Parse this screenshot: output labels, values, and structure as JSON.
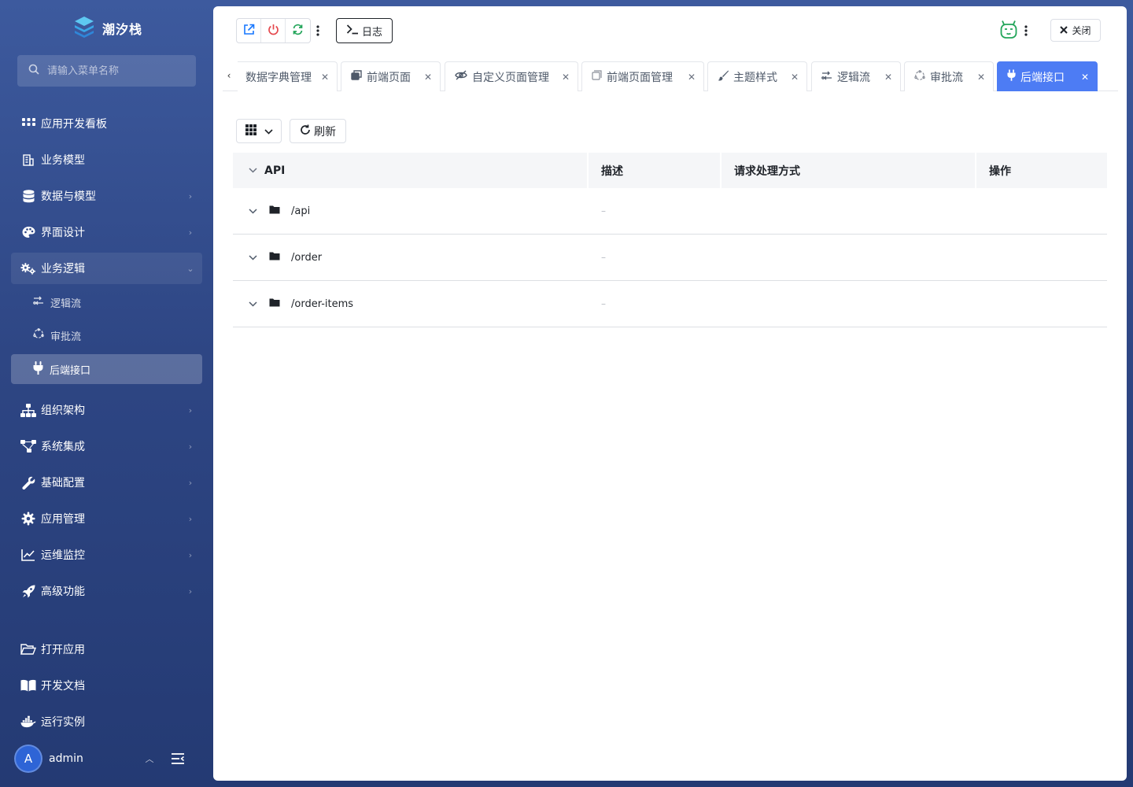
{
  "brand": {
    "name": "潮汐栈"
  },
  "search": {
    "placeholder": "请输入菜单名称"
  },
  "menu": {
    "items": [
      {
        "label": "应用开发看板",
        "icon": "apps-grid-icon"
      },
      {
        "label": "业务模型",
        "icon": "building-icon"
      },
      {
        "label": "数据与模型",
        "icon": "database-icon"
      },
      {
        "label": "界面设计",
        "icon": "palette-icon"
      },
      {
        "label": "业务逻辑",
        "icon": "gears-icon"
      },
      {
        "label": "组织架构",
        "icon": "org-chart-icon"
      },
      {
        "label": "系统集成",
        "icon": "integration-icon"
      },
      {
        "label": "基础配置",
        "icon": "wrench-icon"
      },
      {
        "label": "应用管理",
        "icon": "gear-icon"
      },
      {
        "label": "运维监控",
        "icon": "line-chart-icon"
      },
      {
        "label": "高级功能",
        "icon": "rocket-icon"
      }
    ],
    "sub_items": [
      {
        "label": "逻辑流",
        "icon": "flow-icon"
      },
      {
        "label": "审批流",
        "icon": "approval-icon"
      },
      {
        "label": "后端接口",
        "icon": "plug-icon",
        "active": true
      }
    ],
    "bottom_items": [
      {
        "label": "打开应用",
        "icon": "folder-open-icon"
      },
      {
        "label": "开发文档",
        "icon": "book-icon"
      },
      {
        "label": "运行实例",
        "icon": "docker-icon"
      }
    ]
  },
  "user": {
    "avatar_letter": "A",
    "name": "admin"
  },
  "toolbar": {
    "log_label": "日志",
    "close_label": "关闭",
    "colors": {
      "open": "#1677ff",
      "power": "#e5484d",
      "refresh": "#23a55a",
      "robot": "#23a55a"
    }
  },
  "tabs": [
    {
      "label": "数据字典管理",
      "icon": ""
    },
    {
      "label": "前端页面",
      "icon": "pages-icon"
    },
    {
      "label": "自定义页面管理",
      "icon": "eye-icon"
    },
    {
      "label": "前端页面管理",
      "icon": "window-icon"
    },
    {
      "label": "主题样式",
      "icon": "brush-icon"
    },
    {
      "label": "逻辑流",
      "icon": "flow-icon"
    },
    {
      "label": "审批流",
      "icon": "approval-icon"
    },
    {
      "label": "后端接口",
      "icon": "plug-icon",
      "active": true
    }
  ],
  "content": {
    "refresh_label": "刷新",
    "table": {
      "columns": [
        "API",
        "描述",
        "请求处理方式",
        "操作"
      ],
      "rows": [
        {
          "api": "/api",
          "desc": "–"
        },
        {
          "api": "/order",
          "desc": "–"
        },
        {
          "api": "/order-items",
          "desc": "–"
        }
      ]
    }
  },
  "colors": {
    "accent": "#4d7cf4",
    "sidebar_bg": "#2e4684"
  }
}
